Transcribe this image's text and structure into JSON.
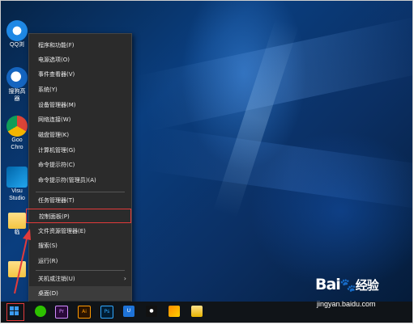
{
  "desktop": {
    "icons": [
      {
        "name": "qq-browser-icon",
        "label": "QQ浏",
        "color": "#1e88e5"
      },
      {
        "name": "sogou-icon",
        "label": "搜狗高",
        "label2": "器",
        "color": "#1565c0"
      },
      {
        "name": "chrome-icon",
        "label": "Goo",
        "label2": "Chro",
        "color": "#4caf50"
      },
      {
        "name": "vscode-icon",
        "label": "Visu",
        "label2": "Studio",
        "color": "#0078d4"
      },
      {
        "name": "folder-icon",
        "label": "临",
        "color": "#f4c542"
      },
      {
        "name": "folder2-icon",
        "label": "",
        "color": "#f4c542"
      }
    ]
  },
  "context_menu": {
    "items": [
      {
        "label": "程序和功能(F)"
      },
      {
        "label": "电源选项(O)"
      },
      {
        "label": "事件查看器(V)"
      },
      {
        "label": "系统(Y)"
      },
      {
        "label": "设备管理器(M)"
      },
      {
        "label": "网络连接(W)"
      },
      {
        "label": "磁盘管理(K)"
      },
      {
        "label": "计算机管理(G)"
      },
      {
        "label": "命令提示符(C)"
      },
      {
        "label": "命令提示符(管理员)(A)"
      },
      {
        "label": "任务管理器(T)"
      },
      {
        "label": "控制面板(P)",
        "highlighted": true
      },
      {
        "label": "文件资源管理器(E)"
      },
      {
        "label": "搜索(S)"
      },
      {
        "label": "运行(R)"
      },
      {
        "label": "关机或注销(U)",
        "submenu": "›"
      },
      {
        "label": "桌面(D)"
      }
    ]
  },
  "taskbar": {
    "apps": [
      {
        "name": "start-button",
        "label": ""
      },
      {
        "name": "wechat-icon",
        "label": ""
      },
      {
        "name": "premiere-icon",
        "label": "Pr"
      },
      {
        "name": "illustrator-icon",
        "label": "Ai"
      },
      {
        "name": "photoshop-icon",
        "label": "Ps"
      },
      {
        "name": "shield-app-icon",
        "label": "U"
      },
      {
        "name": "penguin-icon",
        "label": ""
      },
      {
        "name": "paint-icon",
        "label": ""
      },
      {
        "name": "file-explorer-icon",
        "label": ""
      }
    ]
  },
  "watermark": {
    "brand": "Bai",
    "brand_suffix": "经验",
    "url": "jingyan.baidu.com"
  },
  "colors": {
    "highlight": "#e23b3b",
    "menu_bg": "#2b2b2b",
    "taskbar_bg": "#101418"
  }
}
